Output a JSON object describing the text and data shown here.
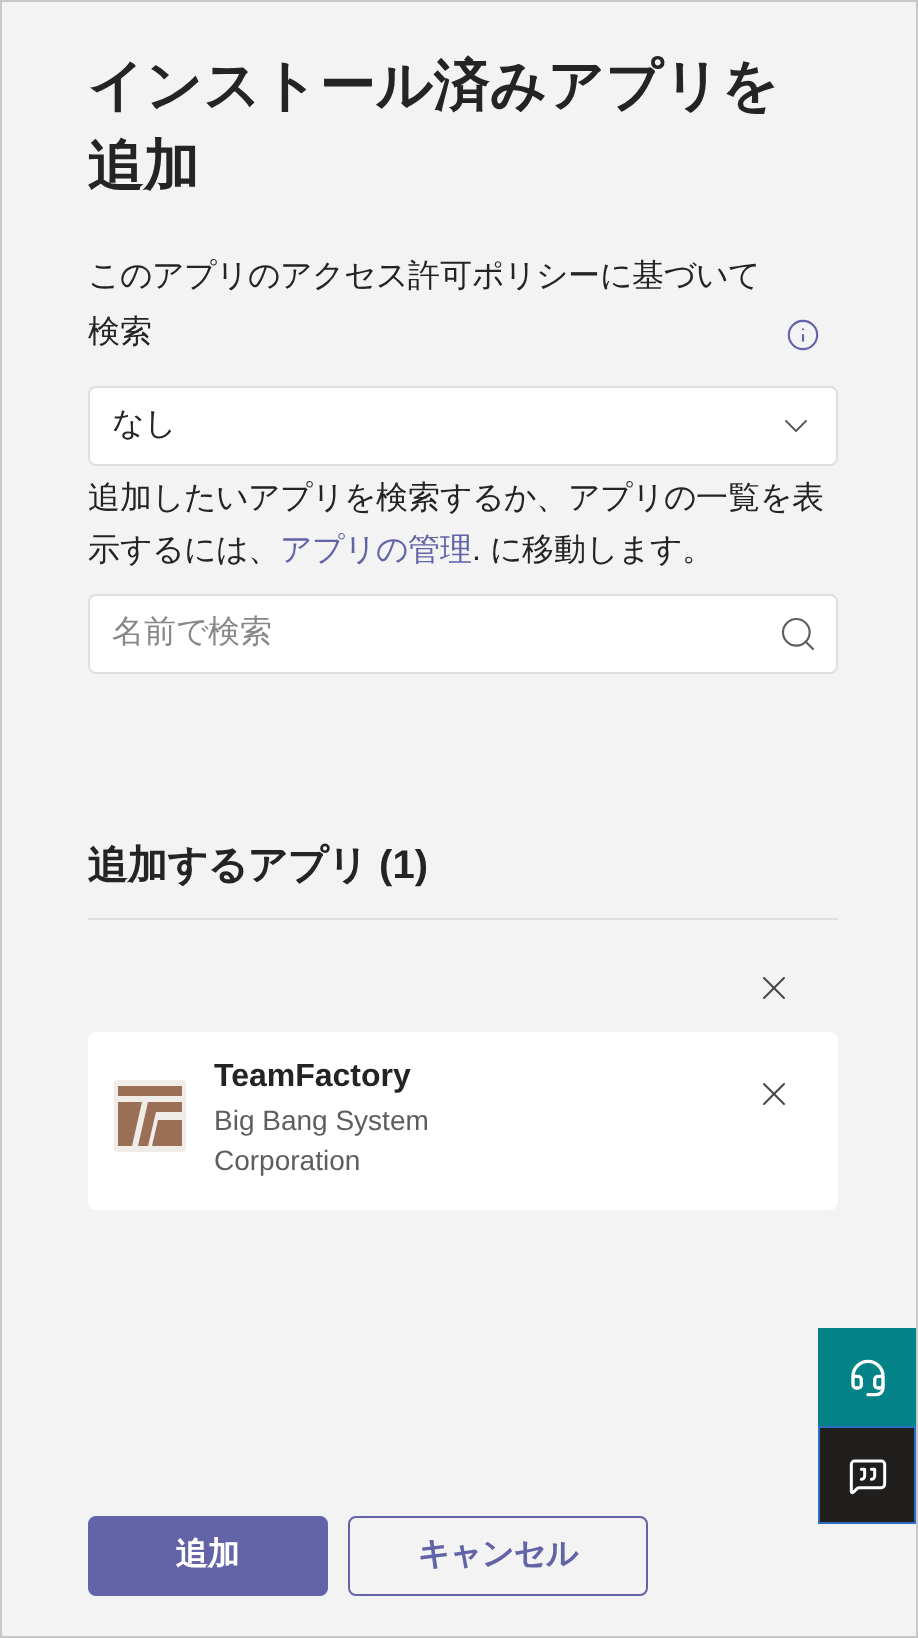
{
  "title": "インストール済みアプリを追加",
  "policy_label": "このアプリのアクセス許可ポリシーに基づいて検索",
  "policy_dropdown": {
    "value": "なし"
  },
  "help_text": {
    "before": "追加したいアプリを検索するか、アプリの一覧を表示するには、",
    "link": "アプリの管理",
    "after": ". に移動します。"
  },
  "search": {
    "placeholder": "名前で検索"
  },
  "apps_section": {
    "heading": "追加するアプリ (1)",
    "apps": [
      {
        "name": "TeamFactory",
        "publisher": "Big Bang System Corporation"
      }
    ]
  },
  "buttons": [
    {
      "label": "追加",
      "kind": "primary"
    },
    {
      "label": "キャンセル",
      "kind": "secondary"
    }
  ]
}
